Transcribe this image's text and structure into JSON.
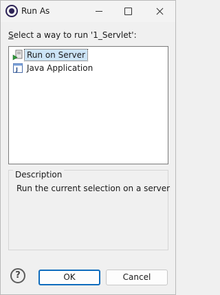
{
  "window": {
    "title": "Run As"
  },
  "prompt": {
    "mnemonic": "S",
    "rest": "elect a way to run '1_Servlet':"
  },
  "launch_options": [
    {
      "label": "Run on Server",
      "icon": "server-run-icon",
      "selected": true
    },
    {
      "label": "Java Application",
      "icon": "java-application-icon",
      "selected": false
    }
  ],
  "description": {
    "legend": "Description",
    "text": "Run the current selection on a server"
  },
  "buttons": {
    "ok": "OK",
    "cancel": "Cancel",
    "help": "?"
  },
  "colors": {
    "selection": "#cce4f7",
    "default_button_border": "#0f6cbd"
  }
}
